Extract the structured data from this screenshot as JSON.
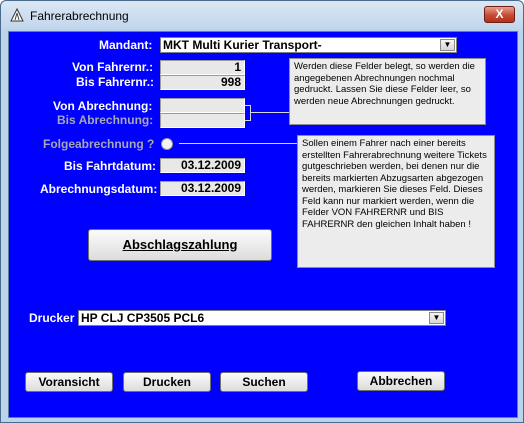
{
  "window": {
    "title": "Fahrerabrechnung",
    "close_symbol": "X"
  },
  "mandant": {
    "label": "Mandant:",
    "value": "MKT Multi Kurier Transport-"
  },
  "von_fahrernr": {
    "label": "Von Fahrernr.:",
    "value": "1"
  },
  "bis_fahrernr": {
    "label": "Bis Fahrernr.:",
    "value": "998"
  },
  "von_abrechnung": {
    "label": "Von Abrechnung:",
    "value": ""
  },
  "bis_abrechnung": {
    "label": "Bis Abrechnung:",
    "value": ""
  },
  "folgeabrechnung": {
    "label": "Folgeabrechnung ?"
  },
  "bis_fahrtdatum": {
    "label": "Bis Fahrtdatum:",
    "value": "03.12.2009"
  },
  "abrechnungsdatum": {
    "label": "Abrechnungsdatum:",
    "value": "03.12.2009"
  },
  "note_fahrer": {
    "text": "Werden diese Felder belegt, so werden die angegebenen Abrechnungen nochmal gedruckt. Lassen Sie diese Felder leer, so werden neue Abrechnungen gedruckt."
  },
  "note_folge": {
    "text": "Sollen einem Fahrer nach einer bereits erstellten Fahrerabrechnung weitere Tickets gutgeschrieben werden, bei denen nur die bereits markierten Abzugsarten abgezogen werden, markieren Sie dieses Feld. Dieses Feld kann nur markiert werden, wenn die Felder VON FAHRERNR und BIS FAHRERNR den gleichen Inhalt haben !"
  },
  "abschlag_button": {
    "label": "Abschlagszahlung"
  },
  "drucker": {
    "label": "Drucker",
    "value": "HP CLJ CP3505 PCL6"
  },
  "buttons": {
    "voransicht": "Voransicht",
    "drucken": "Drucken",
    "suchen": "Suchen",
    "abbrechen": "Abbrechen"
  },
  "icons": {
    "app": "triangle-road-sign-icon",
    "dropdown": "chevron-down-icon",
    "close": "close-icon"
  },
  "colors": {
    "client_bg": "#0000ff",
    "close_button": "#c74a33",
    "note_bg": "#ececec"
  }
}
